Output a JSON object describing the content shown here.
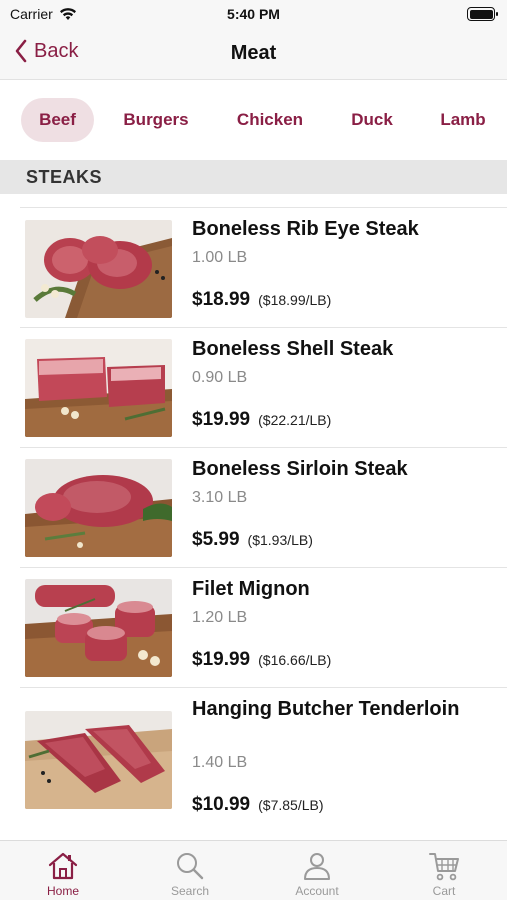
{
  "status": {
    "carrier": "Carrier",
    "time": "5:40 PM"
  },
  "nav": {
    "back_label": "Back",
    "title": "Meat"
  },
  "categories": [
    {
      "label": "Beef",
      "active": true
    },
    {
      "label": "Burgers",
      "active": false
    },
    {
      "label": "Chicken",
      "active": false
    },
    {
      "label": "Duck",
      "active": false
    },
    {
      "label": "Lamb",
      "active": false
    }
  ],
  "section": {
    "title": "STEAKS"
  },
  "products": [
    {
      "name": "Boneless Rib Eye Steak",
      "weight": "1.00 LB",
      "price": "$18.99",
      "unit_price": "($18.99/LB)"
    },
    {
      "name": "Boneless Shell Steak",
      "weight": "0.90 LB",
      "price": "$19.99",
      "unit_price": "($22.21/LB)"
    },
    {
      "name": "Boneless Sirloin Steak",
      "weight": "3.10 LB",
      "price": "$5.99",
      "unit_price": "($1.93/LB)"
    },
    {
      "name": "Filet Mignon",
      "weight": "1.20 LB",
      "price": "$19.99",
      "unit_price": "($16.66/LB)"
    },
    {
      "name": "Hanging Butcher Tenderloin",
      "weight": "1.40 LB",
      "price": "$10.99",
      "unit_price": "($7.85/LB)"
    }
  ],
  "tabs": [
    {
      "label": "Home",
      "icon": "home-icon",
      "active": true
    },
    {
      "label": "Search",
      "icon": "search-icon",
      "active": false
    },
    {
      "label": "Account",
      "icon": "account-icon",
      "active": false
    },
    {
      "label": "Cart",
      "icon": "cart-icon",
      "active": false
    }
  ],
  "colors": {
    "accent": "#8a1f45",
    "accent_light": "#efdfe3",
    "tab_inactive": "#9a9a9a"
  }
}
